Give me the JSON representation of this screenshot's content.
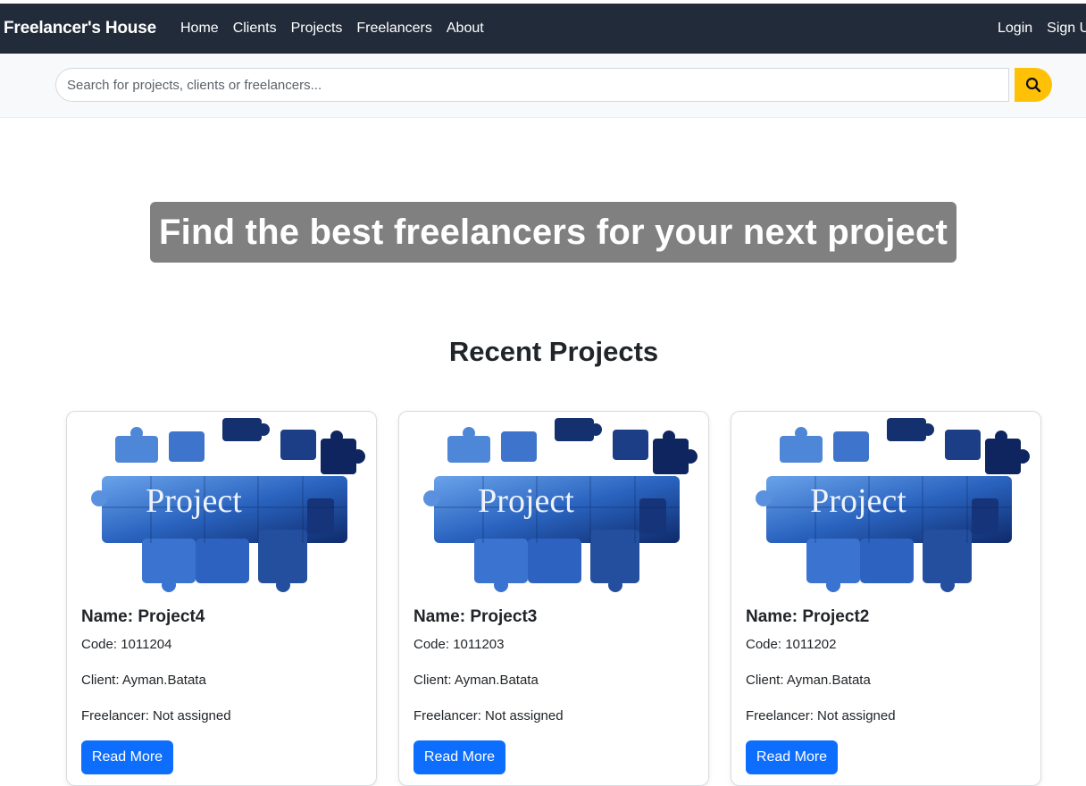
{
  "nav": {
    "brand": "Freelancer's House",
    "links": [
      "Home",
      "Clients",
      "Projects",
      "Freelancers",
      "About"
    ],
    "login": "Login",
    "signup": "Sign Up"
  },
  "search": {
    "placeholder": "Search for projects, clients or freelancers...",
    "button_icon": "search-icon"
  },
  "hero": {
    "title": "Find the best freelancers for your next project"
  },
  "recent": {
    "title": "Recent Projects",
    "projects": [
      {
        "image_text": "Project",
        "name": "Name: Project4",
        "code": "Code: 1011204",
        "client": "Client: Ayman.Batata",
        "freelancer": "Freelancer: Not assigned",
        "button": "Read More"
      },
      {
        "image_text": "Project",
        "name": "Name: Project3",
        "code": "Code: 1011203",
        "client": "Client: Ayman.Batata",
        "freelancer": "Freelancer: Not assigned",
        "button": "Read More"
      },
      {
        "image_text": "Project",
        "name": "Name: Project2",
        "code": "Code: 1011202",
        "client": "Client: Ayman.Batata",
        "freelancer": "Freelancer: Not assigned",
        "button": "Read More"
      }
    ]
  },
  "colors": {
    "navbar": "#212b3a",
    "search_button": "#ffc107",
    "hero_bg": "#808080",
    "primary_button": "#0d6efd"
  }
}
